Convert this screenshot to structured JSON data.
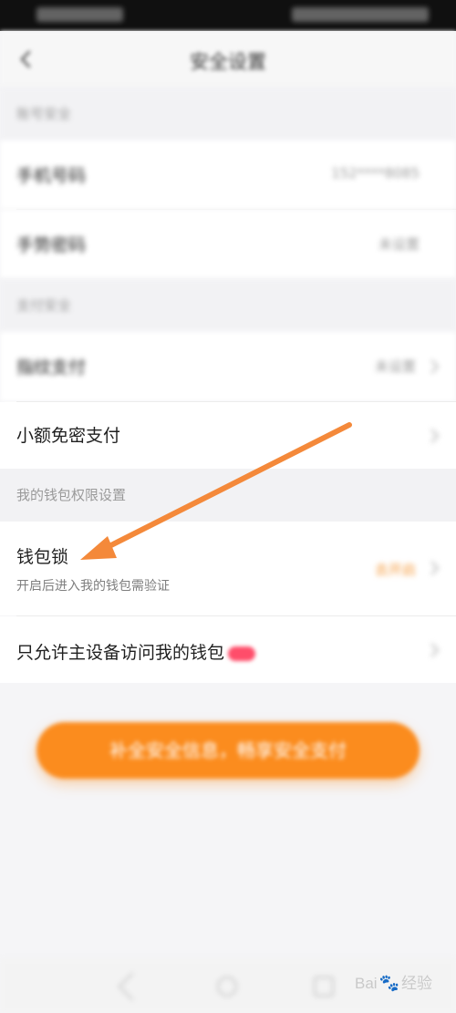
{
  "nav": {
    "title": "安全设置"
  },
  "sections": {
    "account_header": "账号安全",
    "pay_header": "支付安全",
    "wallet_header": "我的钱包权限设置"
  },
  "rows": {
    "phone": {
      "title": "手机号码",
      "value": "152****8085"
    },
    "gesture": {
      "title": "手势密码",
      "value": "未设置"
    },
    "fingerprint": {
      "title": "指纹支付",
      "value": "未设置"
    },
    "small_pay": {
      "title": "小额免密支付"
    },
    "wallet_lock": {
      "title": "钱包锁",
      "subtitle": "开启后进入我的钱包需验证",
      "value": "去开启"
    },
    "main_device": {
      "title": "只允许主设备访问我的钱包"
    }
  },
  "cta": {
    "label": "补全安全信息，畅享安全支付"
  },
  "watermark": {
    "brand": "Bai",
    "brand_suffix": "经验"
  },
  "colors": {
    "accent": "#fb8c1e",
    "arrow": "#f4893a",
    "badge": "#ff4d6a"
  }
}
